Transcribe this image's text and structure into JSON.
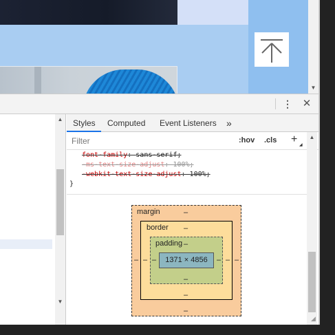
{
  "devtools": {
    "menu_icon": "⋮",
    "close_icon": "✕"
  },
  "styles_pane": {
    "tabs": [
      {
        "label": "Styles"
      },
      {
        "label": "Computed"
      },
      {
        "label": "Event Listeners"
      },
      {
        "label": "»"
      }
    ],
    "filter_placeholder": "Filter",
    "hov_label": ":hov",
    "cls_label": ".cls",
    "add_rule_icon": "+",
    "rules": [
      {
        "property": "font-family",
        "value": "sans-serif;"
      },
      {
        "property": "-ms-text-size-adjust",
        "value": "100%;"
      },
      {
        "property": "-webkit-text-size-adjust",
        "value": "100%;"
      }
    ],
    "closing_brace": "}"
  },
  "box_model": {
    "margin_label": "margin",
    "border_label": "border",
    "padding_label": "padding",
    "content_size": "1371 × 4856",
    "margin": {
      "top": "–",
      "right": "–",
      "bottom": "–",
      "left": "–"
    },
    "border": {
      "top": "–",
      "right": "–",
      "bottom": "–",
      "left": "–"
    },
    "padding": {
      "top": "–",
      "right": "–",
      "bottom": "–",
      "left": "–"
    }
  },
  "colors": {
    "margin": "#f9cc9d",
    "border": "#fddd9b",
    "padding": "#c3cf8a",
    "content": "#8cb6c0",
    "active_tab": "#1a73e8"
  },
  "icons": {
    "back_to_top": "back-to-top-icon"
  }
}
